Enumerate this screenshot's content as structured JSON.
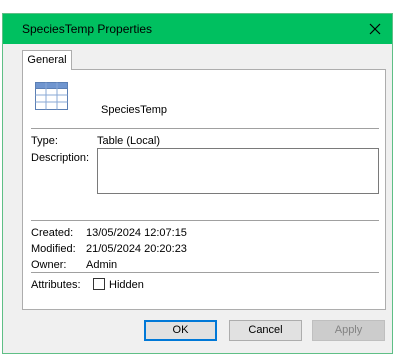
{
  "window": {
    "title": "SpeciesTemp Properties"
  },
  "tabs": [
    {
      "label": "General"
    }
  ],
  "general": {
    "name": "SpeciesTemp",
    "type_label": "Type:",
    "type_value": "Table (Local)",
    "description_label": "Description:",
    "description_value": "",
    "created_label": "Created:",
    "created_value": "13/05/2024 12:07:15",
    "modified_label": "Modified:",
    "modified_value": "21/05/2024 20:20:23",
    "owner_label": "Owner:",
    "owner_value": "Admin",
    "attributes_label": "Attributes:",
    "hidden_label": "Hidden",
    "hidden_checked": false
  },
  "buttons": {
    "ok": "OK",
    "cancel": "Cancel",
    "apply": "Apply"
  },
  "colors": {
    "titlebar": "#00c060",
    "accent": "#0078d7"
  },
  "icons": {
    "object": "table-icon",
    "close": "close-icon"
  }
}
